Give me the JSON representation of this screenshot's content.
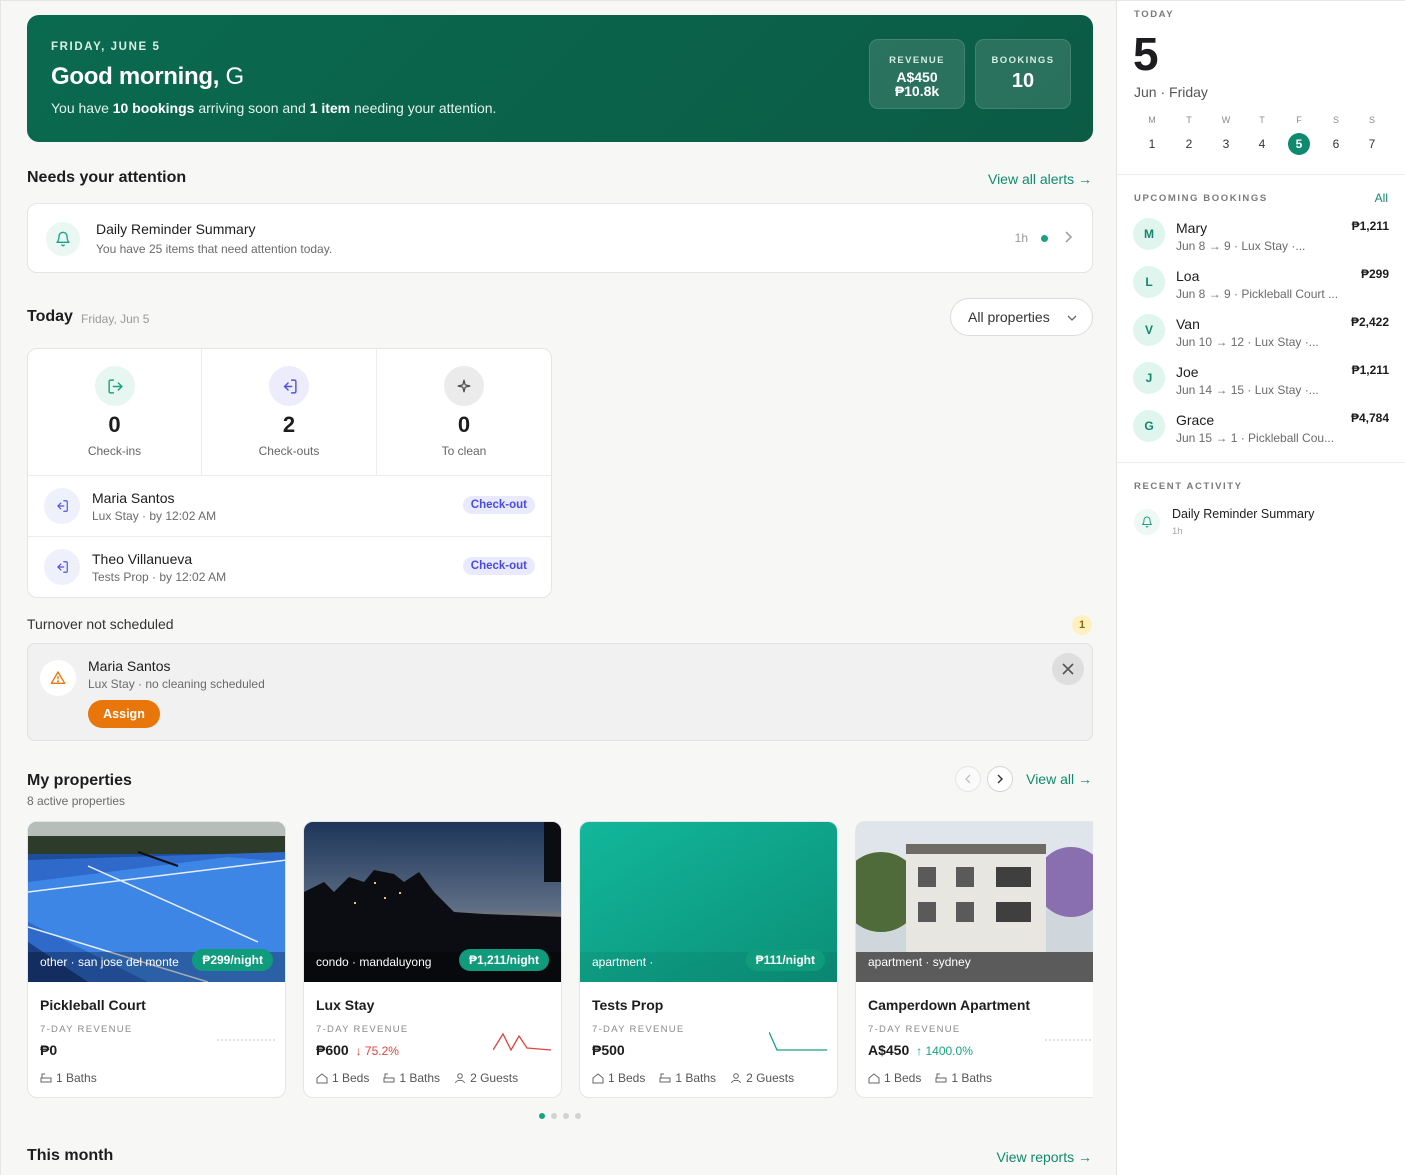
{
  "hero": {
    "date": "FRIDAY, JUNE 5",
    "greeting": "Good morning,",
    "name": "G",
    "sub_1": "You have ",
    "sub_bookings": "10 bookings",
    "sub_2": " arriving soon and ",
    "sub_items": "1 item",
    "sub_3": " needing your attention.",
    "revenue_label": "REVENUE",
    "revenue_aud": "A$450",
    "revenue_php": "₱10.8k",
    "bookings_label": "BOOKINGS",
    "bookings_value": "10"
  },
  "attention": {
    "title": "Needs your attention",
    "view_all": "View all alerts →",
    "item_title": "Daily Reminder Summary",
    "item_sub": "You have 25 items that need attention today.",
    "item_time": "1h"
  },
  "today": {
    "title": "Today",
    "date": "Friday, Jun 5",
    "filter": "All properties",
    "stats": [
      {
        "value": "0",
        "label": "Check-ins"
      },
      {
        "value": "2",
        "label": "Check-outs"
      },
      {
        "value": "0",
        "label": "To clean"
      }
    ],
    "rows": [
      {
        "name": "Maria Santos",
        "sub": "Lux Stay · by 12:02 AM",
        "tag": "Check-out"
      },
      {
        "name": "Theo Villanueva",
        "sub": "Tests Prop · by 12:02 AM",
        "tag": "Check-out"
      }
    ]
  },
  "turnover": {
    "title": "Turnover not scheduled",
    "count": "1",
    "name": "Maria Santos",
    "sub": "Lux Stay · no cleaning scheduled",
    "assign": "Assign"
  },
  "properties": {
    "title": "My properties",
    "sub": "8 active properties",
    "view_all": "View all →",
    "revenue_label": "7-DAY REVENUE",
    "items": [
      {
        "loc": "other · san jose del monte",
        "price": "₱299/night",
        "name": "Pickleball Court",
        "revenue": "₱0",
        "change": "",
        "beds": "",
        "baths": "1 Baths",
        "guests": ""
      },
      {
        "loc": "condo · mandaluyong",
        "price": "₱1,211/night",
        "name": "Lux Stay",
        "revenue": "₱600",
        "change": "↓ 75.2%",
        "beds": "1 Beds",
        "baths": "1 Baths",
        "guests": "2 Guests"
      },
      {
        "loc": "apartment ·",
        "price": "₱111/night",
        "name": "Tests Prop",
        "revenue": "₱500",
        "change": "",
        "beds": "1 Beds",
        "baths": "1 Baths",
        "guests": "2 Guests"
      },
      {
        "loc": "apartment · sydney",
        "price": "",
        "name": "Camperdown Apartment",
        "revenue": "A$450",
        "change": "↑ 1400.0%",
        "beds": "1 Beds",
        "baths": "1 Baths",
        "guests": ""
      }
    ]
  },
  "month": {
    "title": "This month",
    "view_reports": "View reports →"
  },
  "sidebar": {
    "today_label": "TODAY",
    "day": "5",
    "day_sub": "Jun · Friday",
    "week_letters": [
      "M",
      "T",
      "W",
      "T",
      "F",
      "S",
      "S"
    ],
    "week_days": [
      "1",
      "2",
      "3",
      "4",
      "5",
      "6",
      "7"
    ],
    "upcoming_label": "UPCOMING BOOKINGS",
    "upcoming_all": "All",
    "bookings": [
      {
        "initial": "M",
        "name": "Mary",
        "sub": "Jun 8 → 9 · Lux Stay ·...",
        "amount": "₱1,211"
      },
      {
        "initial": "L",
        "name": "Loa",
        "sub": "Jun 8 → 9 · Pickleball Court ...",
        "amount": "₱299"
      },
      {
        "initial": "V",
        "name": "Van",
        "sub": "Jun 10 → 12 · Lux Stay ·...",
        "amount": "₱2,422"
      },
      {
        "initial": "J",
        "name": "Joe",
        "sub": "Jun 14 → 15 · Lux Stay ·...",
        "amount": "₱1,211"
      },
      {
        "initial": "G",
        "name": "Grace",
        "sub": "Jun 15 → 1 · Pickleball Cou...",
        "amount": "₱4,784"
      }
    ],
    "activity_label": "RECENT ACTIVITY",
    "activity_title": "Daily Reminder Summary",
    "activity_time": "1h"
  },
  "colors": {
    "brand": "#0a6a4f",
    "accent": "#118a6c",
    "warning": "#e8760a",
    "negative": "#e0443e"
  }
}
